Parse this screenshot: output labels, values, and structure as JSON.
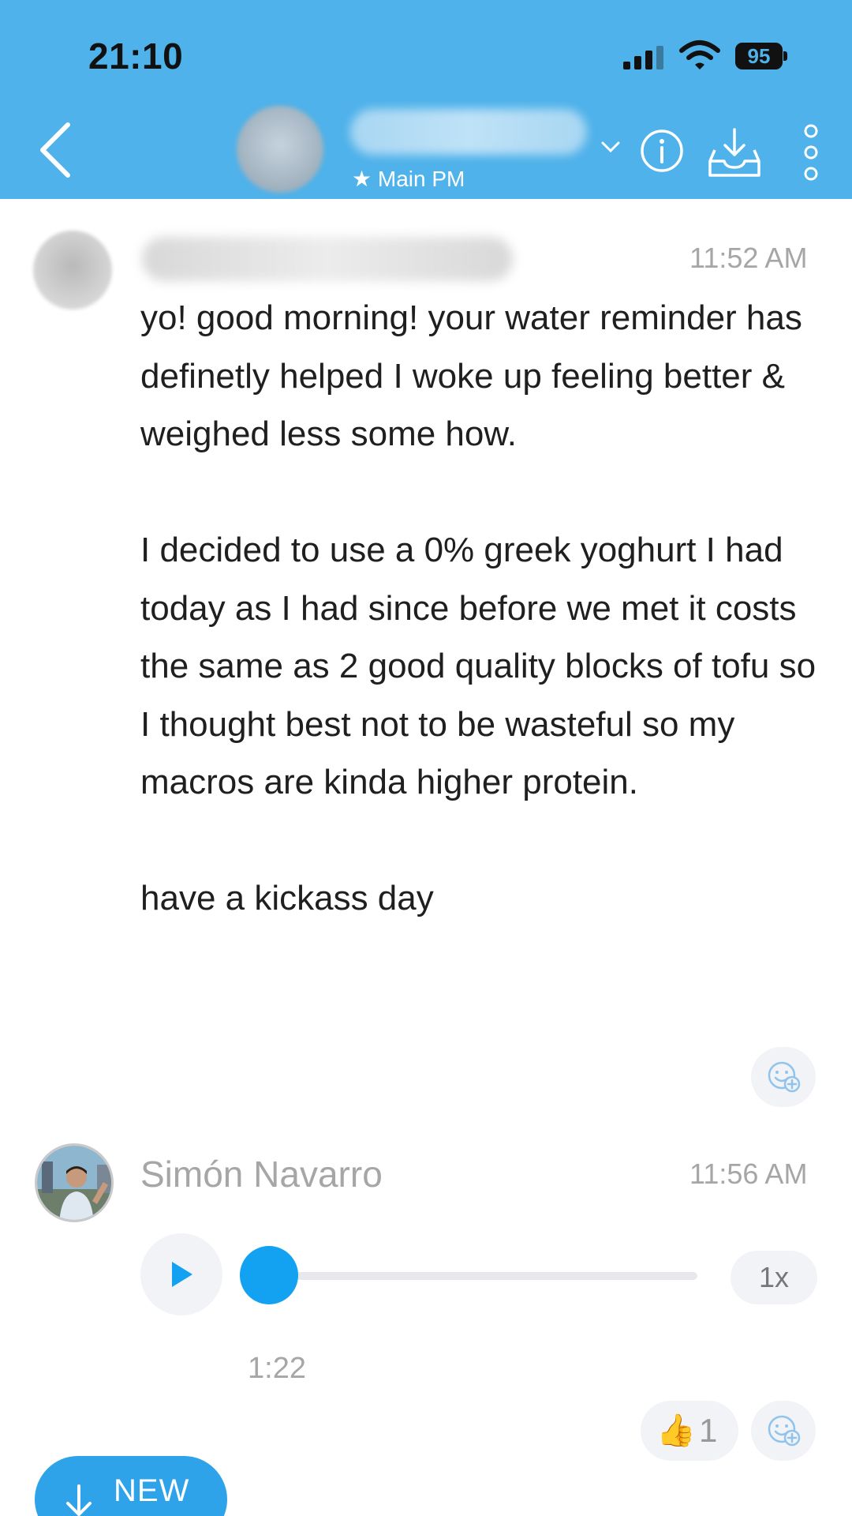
{
  "status_bar": {
    "time": "21:10",
    "battery": "95"
  },
  "header": {
    "subtitle": "★ Main PM",
    "colors": {
      "background": "#4fb2ea",
      "text": "#ffffff"
    },
    "icons": [
      "back-chevron-icon",
      "chevron-down-icon",
      "info-icon",
      "inbox-download-icon",
      "more-vertical-icon"
    ]
  },
  "messages": [
    {
      "time": "11:52 AM",
      "paragraphs": [
        "yo! good morning! your water reminder has definetly helped I woke up feeling better & weighed less some how.",
        "I decided to use a 0% greek yoghurt I had today as I had since before we met it costs the same as 2 good quality blocks of tofu so I thought best not to be wasteful so my macros are kinda higher protein.",
        "have a kickass day"
      ]
    },
    {
      "sender": "Simón Navarro",
      "time": "11:56 AM",
      "voice_note": {
        "duration": "1:22",
        "speed": "1x",
        "progress": 0
      },
      "reactions": [
        {
          "emoji": "👍",
          "count": "1"
        }
      ]
    }
  ],
  "new_button": {
    "label": "NEW"
  },
  "accent_color": "#13a1f2"
}
